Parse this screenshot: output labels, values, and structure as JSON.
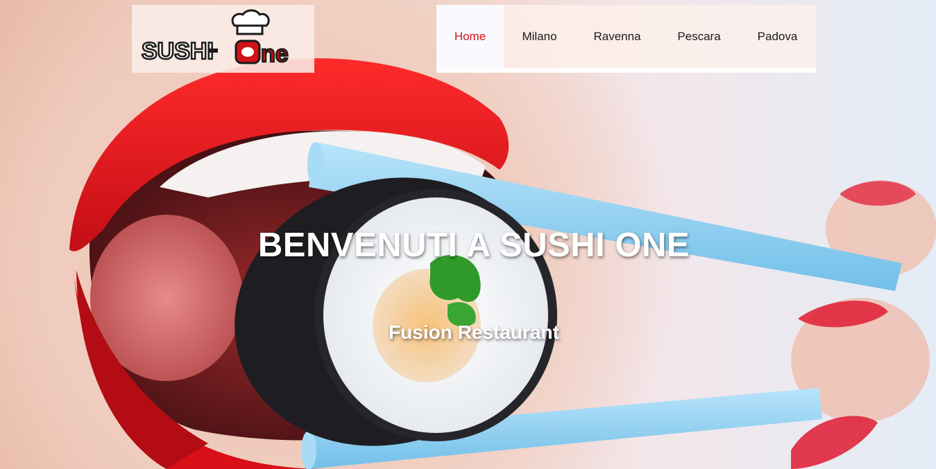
{
  "logo": {
    "alt": "SUSHI-One",
    "text_left": "SUSHI",
    "text_right": "ne"
  },
  "nav": {
    "items": [
      {
        "label": "Home",
        "active": true
      },
      {
        "label": "Milano",
        "active": false
      },
      {
        "label": "Ravenna",
        "active": false
      },
      {
        "label": "Pescara",
        "active": false
      },
      {
        "label": "Padova",
        "active": false
      }
    ]
  },
  "hero": {
    "title": "BENVENUTI A SUSHI ONE",
    "subtitle": "Fusion Restaurant",
    "image": "woman-eating-sushi-roll-with-chopsticks"
  },
  "colors": {
    "accent": "#d0121a",
    "lips": "#e0141c",
    "chopsticks": "#8fd0f0"
  }
}
